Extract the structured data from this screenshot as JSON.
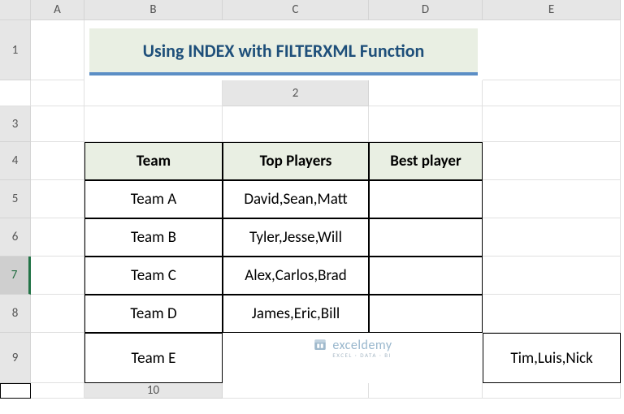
{
  "columns": [
    "A",
    "B",
    "C",
    "D",
    "E"
  ],
  "rows": [
    "1",
    "2",
    "3",
    "4",
    "5",
    "6",
    "7",
    "8",
    "9",
    "10"
  ],
  "selected_row_index": 6,
  "title": "Using INDEX with FILTERXML Function",
  "table": {
    "headers": [
      "Team",
      "Top Players",
      "Best player"
    ],
    "rows": [
      {
        "team": "Team A",
        "players": "David,Sean,Matt",
        "best": ""
      },
      {
        "team": "Team B",
        "players": "Tyler,Jesse,Will",
        "best": ""
      },
      {
        "team": "Team C",
        "players": "Alex,Carlos,Brad",
        "best": ""
      },
      {
        "team": "Team D",
        "players": "James,Eric,Bill",
        "best": ""
      },
      {
        "team": "Team E",
        "players": "Tim,Luis,Nick",
        "best": ""
      }
    ]
  },
  "brand": {
    "name": "exceldemy",
    "tag": "EXCEL · DATA · BI"
  }
}
